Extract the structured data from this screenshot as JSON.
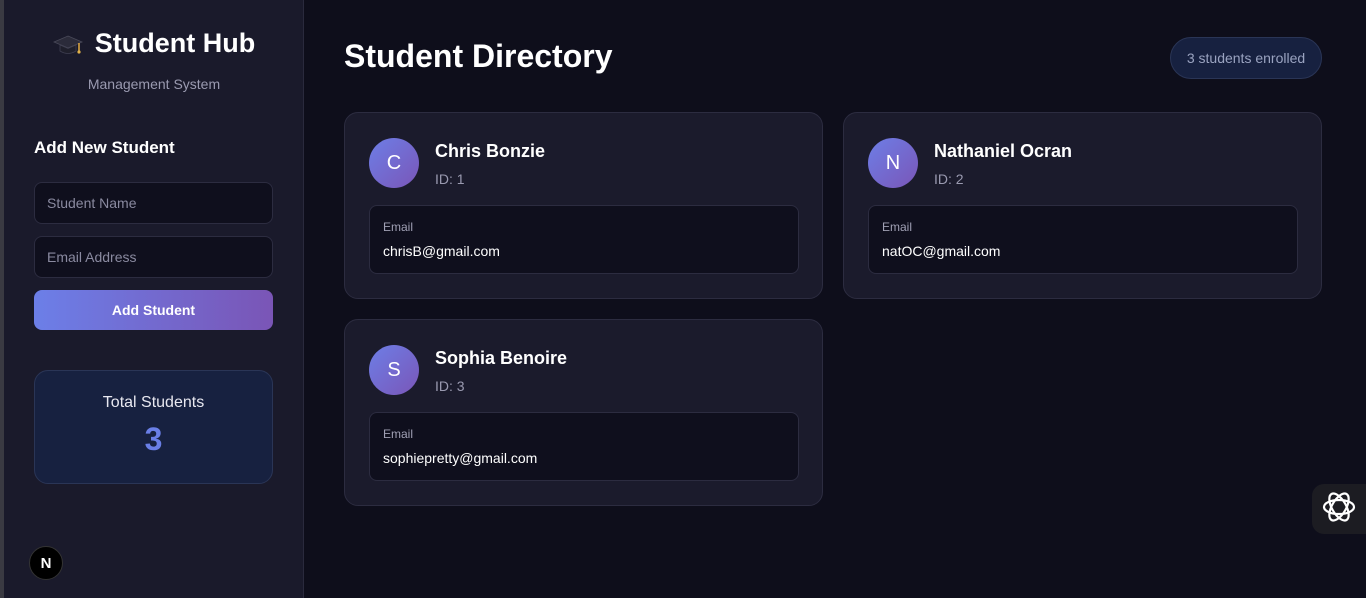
{
  "sidebar": {
    "brand": {
      "name": "Student Hub",
      "subtitle": "Management System",
      "icon": "graduation-cap-icon"
    },
    "form": {
      "title": "Add New Student",
      "name_placeholder": "Student Name",
      "email_placeholder": "Email Address",
      "submit_label": "Add Student"
    },
    "stats": {
      "label": "Total Students",
      "value": "3"
    }
  },
  "main": {
    "title": "Student Directory",
    "enrolled_badge": "3 students enrolled",
    "email_label": "Email",
    "students": [
      {
        "initial": "C",
        "name": "Chris Bonzie",
        "id": "ID: 1",
        "email": "chrisB@gmail.com"
      },
      {
        "initial": "N",
        "name": "Nathaniel Ocran",
        "id": "ID: 2",
        "email": "natOC@gmail.com"
      },
      {
        "initial": "S",
        "name": "Sophia Benoire",
        "id": "ID: 3",
        "email": "sophiepretty@gmail.com"
      }
    ]
  },
  "overlay": {
    "next_badge": "N",
    "assistant_icon": "openai-logo-icon"
  },
  "colors": {
    "background": "#0e0e1b",
    "sidebar": "#1a1a2b",
    "card": "#1b1b2c",
    "accent_start": "#6c7fe8",
    "accent_end": "#7a55b6",
    "stat_value": "#6a7fe6"
  }
}
